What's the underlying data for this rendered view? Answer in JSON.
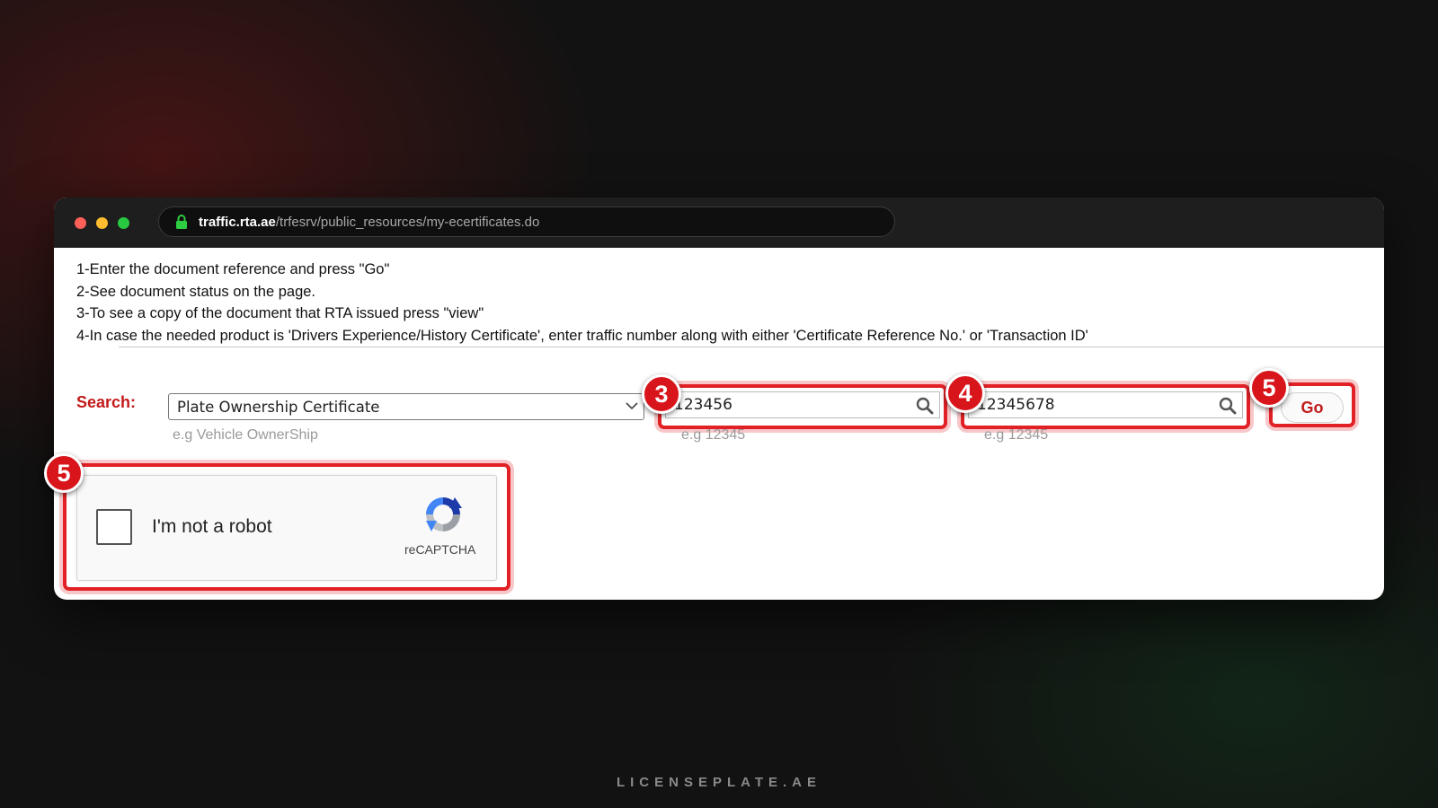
{
  "browser": {
    "url_host": "traffic.rta.ae",
    "url_path": "/trfesrv/public_resources/my-ecertificates.do",
    "window_buttons": [
      "close",
      "minimize",
      "maximize"
    ]
  },
  "instructions": [
    "1-Enter the document reference and press \"Go\"",
    "2-See document status on the page.",
    "3-To see a copy of the document that RTA issued press \"view\"",
    "4-In case the needed product is 'Drivers Experience/History Certificate', enter traffic number along with either 'Certificate Reference No.' or 'Transaction ID'"
  ],
  "search": {
    "label": "Search:",
    "select_value": "Plate Ownership Certificate",
    "select_hint": "e.g Vehicle OwnerShip",
    "field1_value": "123456",
    "field1_hint": "e.g 12345",
    "field2_value": "12345678",
    "field2_hint": "e.g 12345",
    "go_label": "Go"
  },
  "badges": {
    "field1": "3",
    "field2": "4",
    "go": "5",
    "captcha": "5"
  },
  "captcha": {
    "label": "I'm not a robot",
    "brand": "reCAPTCHA"
  },
  "footer": "LICENSEPLATE.AE",
  "colors": {
    "accent_red": "#c21b1b",
    "highlight_red": "#e12126",
    "badge_red": "#d8151b"
  },
  "icons": [
    "lock-icon",
    "chevron-down-icon",
    "search-icon",
    "recaptcha-logo-icon"
  ]
}
